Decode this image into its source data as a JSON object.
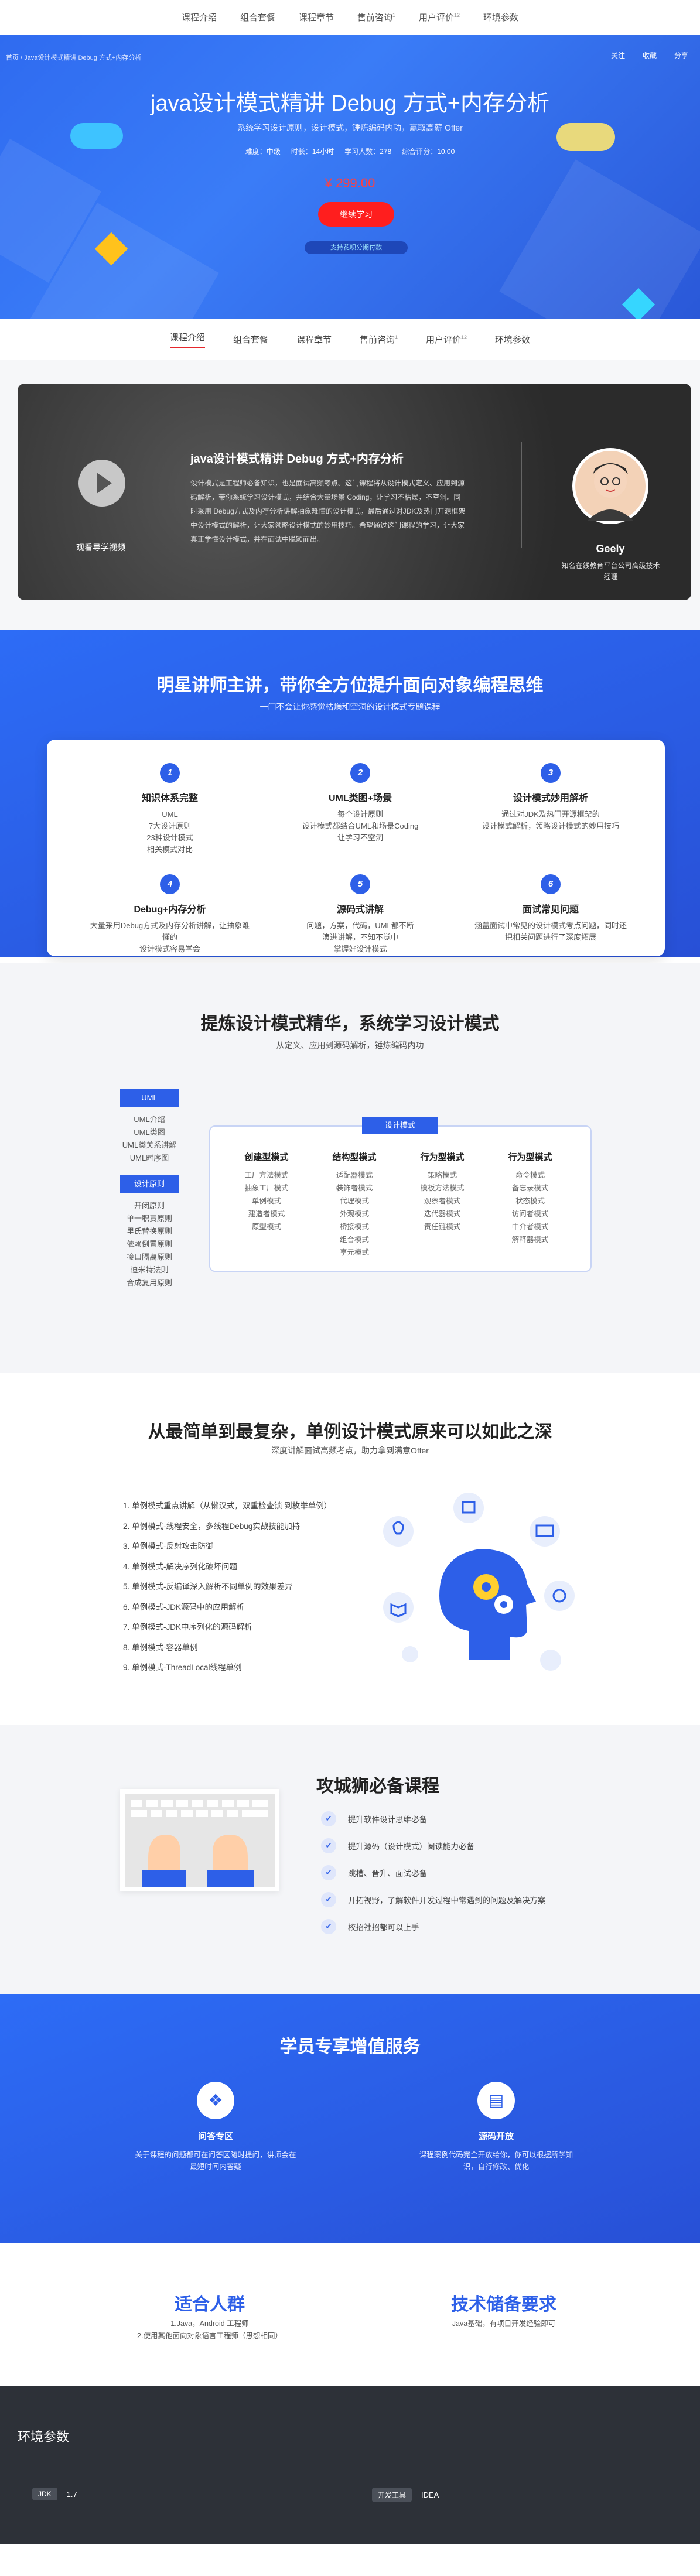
{
  "topnav": {
    "items": [
      "课程介绍",
      "组合套餐",
      "课程章节",
      "售前咨询",
      "用户评价",
      "环境参数"
    ],
    "counts": {
      "售前咨询": "1",
      "用户评价": "12"
    }
  },
  "hero": {
    "breadcrumb": "首页 \\ Java设计模式精讲 Debug 方式+内存分析",
    "tools": [
      "关注",
      "收藏",
      "分享"
    ],
    "title": "java设计模式精讲 Debug 方式+内存分析",
    "subtitle": "系统学习设计原则，设计模式，锤炼编码内功，赢取高薪 Offer",
    "meta": [
      {
        "k": "难度",
        "v": "中级"
      },
      {
        "k": "时长",
        "v": "14小时"
      },
      {
        "k": "学习人数",
        "v": "278"
      },
      {
        "k": "综合评分",
        "v": "10.00"
      }
    ],
    "price": "¥ 299.00",
    "buy": "继续学习",
    "pay": "支持花呗分期付款"
  },
  "tabs": {
    "items": [
      "课程介绍",
      "组合套餐",
      "课程章节",
      "售前咨询",
      "用户评价",
      "环境参数"
    ],
    "active": "课程介绍",
    "counts": {
      "售前咨询": "1",
      "用户评价": "12"
    }
  },
  "intro": {
    "video_label": "观看导学视频",
    "title": "java设计模式精讲 Debug 方式+内存分析",
    "desc": "设计模式是工程师必备知识，也是面试高频考点。这门课程将从设计模式定义、应用到源码解析，带你系统学习设计模式，并结合大量场景 Coding，让学习不枯燥，不空洞。同时采用 Debug方式及内存分析讲解抽象难懂的设计模式，最后通过对JDK及热门开源框架中设计模式的解析，让大家领略设计模式的妙用技巧。希望通过这门课程的学习，让大家真正学懂设计模式，并在面试中脱颖而出。",
    "teacher_name": "Geely",
    "teacher_title": "知名在线教育平台公司高级技术经理"
  },
  "teacher": {
    "title": "明星讲师主讲，带你全方位提升面向对象编程思维",
    "subtitle": "一门不会让你感觉枯燥和空洞的设计模式专题课程",
    "features": [
      {
        "n": "1",
        "title": "知识体系完整",
        "desc": [
          "UML",
          "7大设计原则",
          "23种设计模式",
          "相关模式对比"
        ]
      },
      {
        "n": "2",
        "title": "UML类图+场景",
        "desc": [
          "每个设计原则",
          "设计模式都结合UML和场景Coding",
          "让学习不空洞"
        ]
      },
      {
        "n": "3",
        "title": "设计模式妙用解析",
        "desc": [
          "通过对JDK及热门开源框架的",
          "设计模式解析，领略设计模式的妙用技巧"
        ]
      },
      {
        "n": "4",
        "title": "Debug+内存分析",
        "desc": [
          "大量采用Debug方式及内存分析讲解，让抽象难懂的",
          "设计模式容易学会"
        ]
      },
      {
        "n": "5",
        "title": "源码式讲解",
        "desc": [
          "问题，方案，代码，UML都不断",
          "演进讲解，不知不觉中",
          "掌握好设计模式"
        ]
      },
      {
        "n": "6",
        "title": "面试常见问题",
        "desc": [
          "涵盖面试中常见的设计模式考点问题，同时还",
          "把相关问题进行了深度拓展"
        ]
      }
    ]
  },
  "patterns": {
    "title": "提炼设计模式精华，系统学习设计模式",
    "subtitle": "从定义、应用到源码解析，锤炼编码内功",
    "uml": {
      "label": "UML",
      "items": [
        "UML介绍",
        "UML类图",
        "UML类关系讲解",
        "UML时序图"
      ]
    },
    "principles": {
      "label": "设计原则",
      "items": [
        "开闭原则",
        "单一职责原则",
        "里氏替换原则",
        "依赖倒置原则",
        "接口隔离原则",
        "迪米特法则",
        "合成复用原则"
      ]
    },
    "tag": "设计模式",
    "columns": [
      {
        "title": "创建型模式",
        "items": [
          "工厂方法模式",
          "抽象工厂模式",
          "单例模式",
          "建造者模式",
          "原型模式"
        ]
      },
      {
        "title": "结构型模式",
        "items": [
          "适配器模式",
          "装饰者模式",
          "代理模式",
          "外观模式",
          "桥接模式",
          "组合模式",
          "享元模式"
        ]
      },
      {
        "title": "行为型模式",
        "items": [
          "策略模式",
          "模板方法模式",
          "观察者模式",
          "迭代器模式",
          "责任链模式"
        ]
      },
      {
        "title": "行为型模式",
        "items": [
          "命令模式",
          "备忘录模式",
          "状态模式",
          "访问者模式",
          "中介者模式",
          "解释器模式"
        ]
      }
    ]
  },
  "singleton": {
    "title": "从最简单到最复杂，单例设计模式原来可以如此之深",
    "subtitle": "深度讲解面试高频考点，助力拿到满意Offer",
    "items": [
      "1. 单例模式重点讲解（从懒汉式，双重检查锁 到枚举单例）",
      "2. 单例模式-线程安全，多线程Debug实战技能加持",
      "3. 单例模式-反射攻击防御",
      "4. 单例模式-解决序列化破坏问题",
      "5. 单例模式-反编译深入解析不同单例的效果差异",
      "6. 单例模式-JDK源码中的应用解析",
      "7. 单例模式-JDK中序列化的源码解析",
      "8. 单例模式-容器单例",
      "9. 单例模式-ThreadLocal线程单例"
    ]
  },
  "required": {
    "title": "攻城狮必备课程",
    "items": [
      "提升软件设计思维必备",
      "提升源码（设计模式）阅读能力必备",
      "跳槽、晋升、面试必备",
      "开拓视野，了解软件开发过程中常遇到的问题及解决方案",
      "校招社招都可以上手"
    ]
  },
  "services": {
    "title": "学员专享增值服务",
    "items": [
      {
        "icon": "qa-icon",
        "title": "问答专区",
        "desc": "关于课程的问题都可在问答区随时提问，讲师会在最短时间内答疑"
      },
      {
        "icon": "source-icon",
        "title": "源码开放",
        "desc": "课程案例代码完全开放给你，你可以根据所学知识，自行修改、优化"
      }
    ]
  },
  "audience": {
    "left_title": "适合人群",
    "left_desc": [
      "1.Java，Android 工程师",
      "2.使用其他面向对象语言工程师（思想相同）"
    ],
    "right_title": "技术储备要求",
    "right_desc": [
      "Java基础，有项目开发经验即可"
    ]
  },
  "env": {
    "title": "环境参数",
    "items": [
      {
        "tag": "JDK",
        "value": "1.7"
      },
      {
        "tag": "开发工具",
        "value": "IDEA"
      }
    ]
  },
  "colors": {
    "primary": "#2d5fe8",
    "buy": "#ff1e1e",
    "price": "#ff4040",
    "dark": "#2d3138"
  }
}
